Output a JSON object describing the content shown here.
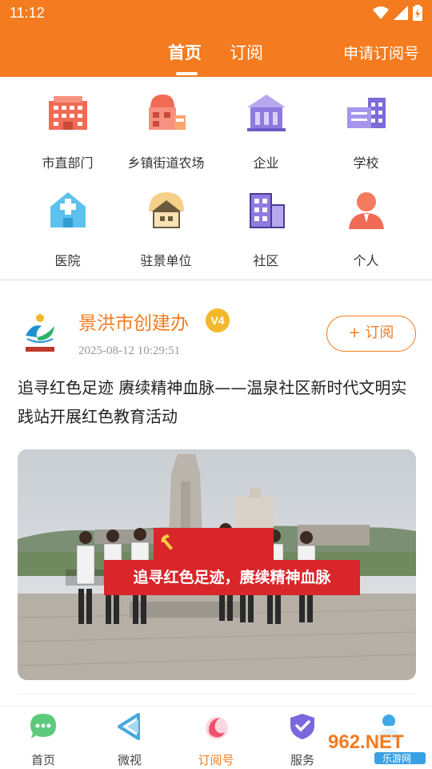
{
  "status_bar": {
    "time": "11:12"
  },
  "header": {
    "tabs": [
      {
        "label": "首页",
        "active": true
      },
      {
        "label": "订阅",
        "active": false
      }
    ],
    "apply_link": "申请订阅号",
    "accent_color": "#F47B1F"
  },
  "categories": [
    {
      "label": "市直部门",
      "icon": "building-icon"
    },
    {
      "label": "乡镇街道农场",
      "icon": "town-hall-icon"
    },
    {
      "label": "企业",
      "icon": "enterprise-icon"
    },
    {
      "label": "学校",
      "icon": "school-icon"
    },
    {
      "label": "医院",
      "icon": "hospital-icon"
    },
    {
      "label": "驻景单位",
      "icon": "unit-icon"
    },
    {
      "label": "社区",
      "icon": "community-icon"
    },
    {
      "label": "个人",
      "icon": "person-icon"
    }
  ],
  "post": {
    "author": "景洪市创建办",
    "badge": "V4",
    "time": "2025-08-12 10:29:51",
    "subscribe_label": "+ 订阅",
    "title": "追寻红色足迹 赓续精神血脉——温泉社区新时代文明实践站开展红色教育活动",
    "image_caption": "追寻红色足迹，赓续精神血脉"
  },
  "bottom_nav": [
    {
      "label": "首页",
      "icon": "chat-bubble-icon",
      "active": false
    },
    {
      "label": "微视",
      "icon": "play-triangle-icon",
      "active": false
    },
    {
      "label": "订阅号",
      "icon": "subscription-icon",
      "active": true
    },
    {
      "label": "服务",
      "icon": "shield-check-icon",
      "active": false
    },
    {
      "label": "",
      "icon": "user-icon",
      "active": false
    }
  ],
  "watermark": {
    "text": "962.NET",
    "sub": "乐游网"
  }
}
